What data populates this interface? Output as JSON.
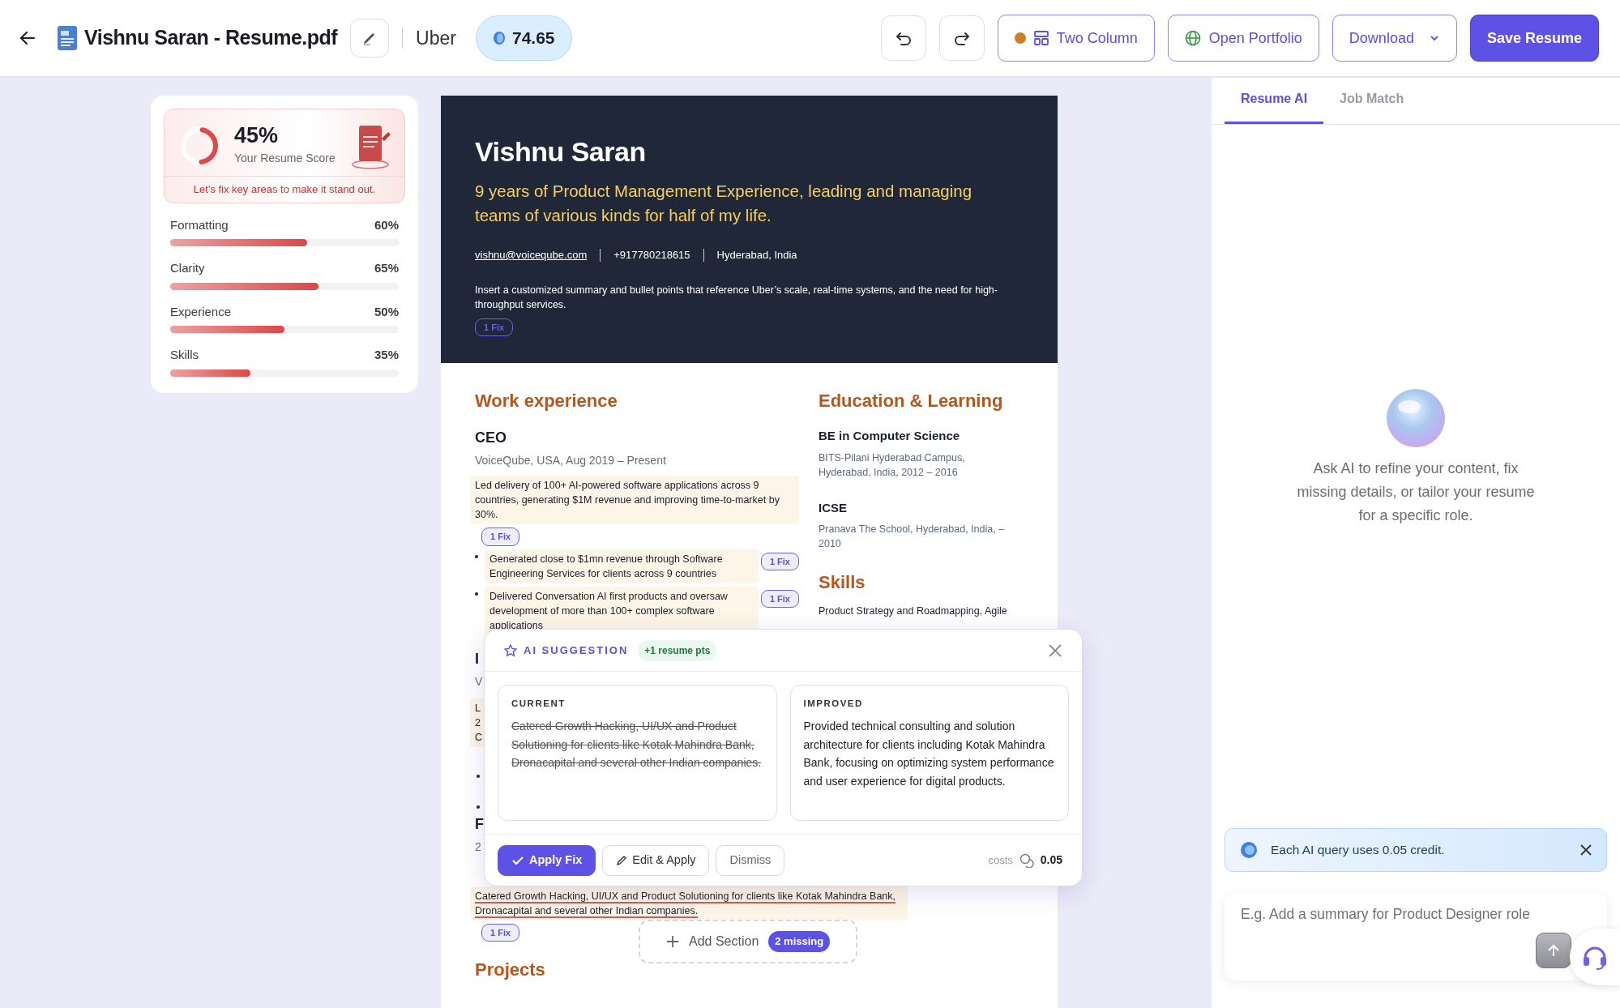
{
  "header": {
    "title": "Vishnu Saran - Resume.pdf",
    "company": "Uber",
    "score": "74.65",
    "buttons": [
      {
        "kind": "layout",
        "label": "Two Column"
      },
      {
        "kind": "portfolio",
        "label": "Open Portfolio"
      },
      {
        "kind": "download",
        "label": "Download"
      },
      {
        "kind": "save",
        "label": "Save Resume"
      }
    ]
  },
  "score_card": {
    "percent": "45%",
    "level": 0.45,
    "label": "Your Resume Score",
    "message": "Let's fix key areas to make it stand out.",
    "metrics": [
      {
        "name": "Formatting",
        "value": "60%",
        "level": 0.6
      },
      {
        "name": "Clarity",
        "value": "65%",
        "level": 0.65
      },
      {
        "name": "Experience",
        "value": "50%",
        "level": 0.5
      },
      {
        "name": "Skills",
        "value": "35%",
        "level": 0.35
      }
    ]
  },
  "resume": {
    "name": "Vishnu Saran",
    "tagline": "9 years of Product Management Experience, leading and managing teams of various kinds for half of my life.",
    "contacts": [
      {
        "kind": "email",
        "text": "vishnu@voiceqube.com"
      },
      {
        "kind": "plain",
        "text": "+917780218615"
      },
      {
        "kind": "plain",
        "text": "Hyderabad, India"
      }
    ],
    "summary": "Insert a customized summary and bullet points that reference Uber’s scale, real-time systems, and the need for high-throughput services.",
    "summary_fix": "1 Fix",
    "work": {
      "heading": "Work experience",
      "role": "CEO",
      "meta": "VoiceQube, USA, Aug 2019 – Present",
      "paragraph": "Led delivery of 100+ AI-powered software applications across 9 countries, generating $1M revenue and improving time-to-market by 30%.",
      "paragraph_fix": "1 Fix",
      "bullets": [
        {
          "text": "Generated close to $1mn revenue through Software Engineering Services for clients across 9 countries",
          "fix": "1 Fix"
        },
        {
          "text": "Delivered Conversation AI first products and oversaw development of more than 100+ complex software applications",
          "fix": "1 Fix"
        }
      ],
      "covered": [
        {
          "kind": "heading",
          "text": "I"
        },
        {
          "kind": "meta",
          "text": "V"
        },
        {
          "kind": "para",
          "lines": [
            "L",
            "2",
            "C"
          ]
        },
        {
          "kind": "bullet"
        },
        {
          "kind": "bullet"
        },
        {
          "kind": "heading",
          "text": "F"
        },
        {
          "kind": "meta",
          "text": "2"
        }
      ],
      "last_paragraph": {
        "text": "Catered Growth Hacking, UI/UX and Product Solutioning for clients like Kotak Mahindra Bank, Dronacapital and several other Indian companies.",
        "flagged": true,
        "fix": "1 Fix"
      }
    },
    "education": {
      "heading": "Education & Learning",
      "items": [
        {
          "title": "BE in Computer Science",
          "detail": "BITS-Pilani Hyderabad Campus, Hyderabad, India, 2012 – 2016"
        },
        {
          "title": "ICSE",
          "detail": "Pranava The School, Hyderabad, India, – 2010"
        }
      ]
    },
    "skills": {
      "heading": "Skills",
      "text": "Product Strategy and Roadmapping, Agile"
    },
    "add_section": {
      "label": "Add Section",
      "badge": "2 missing"
    },
    "projects_heading": "Projects"
  },
  "suggestion": {
    "title": "AI SUGGESTION",
    "badge": "+1 resume pts",
    "panes": [
      {
        "kind": "current",
        "label": "CURRENT",
        "text": "Catered Growth Hacking, UI/UX and Product Solutioning for clients like Kotak Mahindra Bank, Dronacapital and several other Indian companies."
      },
      {
        "kind": "improved",
        "label": "IMPROVED",
        "text": "Provided technical consulting and solution architecture for clients including Kotak Mahindra Bank, focusing on optimizing system performance and user experience for digital products."
      }
    ],
    "actions": [
      {
        "kind": "apply",
        "label": "Apply Fix"
      },
      {
        "kind": "edit",
        "label": "Edit & Apply"
      },
      {
        "kind": "dismiss",
        "label": "Dismiss"
      }
    ],
    "cost_label": "costs",
    "cost": "0.05"
  },
  "assistant": {
    "tabs": [
      {
        "label": "Resume AI",
        "selected": true
      },
      {
        "label": "Job Match",
        "selected": false
      }
    ],
    "prompt": "Ask AI to refine your content, fix missing details, or tailor your resume for a specific role.",
    "notice": "Each AI query uses 0.05 credit.",
    "placeholder": "E.g. Add a summary for Product Designer role"
  }
}
